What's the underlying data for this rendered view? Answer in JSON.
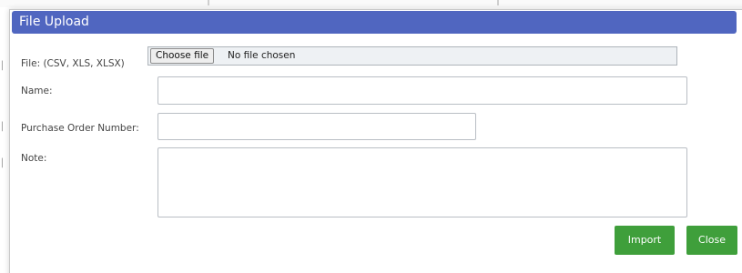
{
  "dialog": {
    "title": "File Upload"
  },
  "form": {
    "file_label": "File: (CSV, XLS, XLSX)",
    "choose_file_label": "Choose file",
    "file_status": "No file chosen",
    "name_label": "Name:",
    "name_value": "",
    "po_label": "Purchase Order Number:",
    "po_value": "",
    "note_label": "Note:",
    "note_value": ""
  },
  "actions": {
    "import_label": "Import",
    "close_label": "Close"
  },
  "colors": {
    "header_bg": "#5066c0",
    "button_bg": "#3f9f3b"
  }
}
